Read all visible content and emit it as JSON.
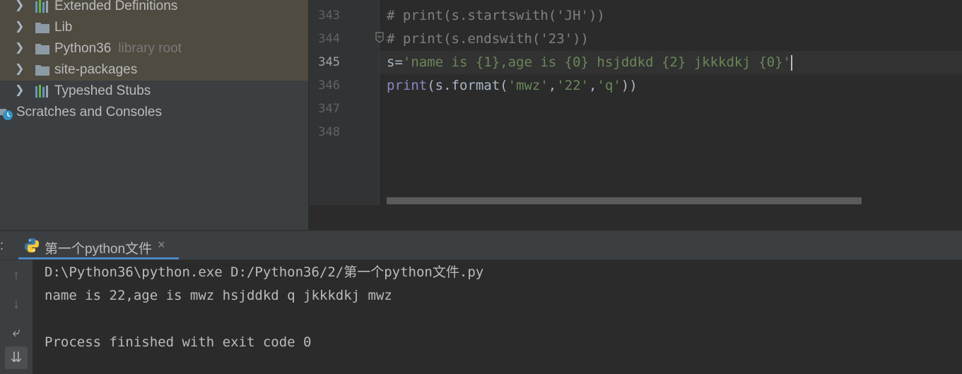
{
  "project_tree": {
    "items": [
      {
        "label": "Extended Definitions",
        "icon": "library-icon"
      },
      {
        "label": "Lib",
        "icon": "folder-icon"
      },
      {
        "label": "Python36",
        "sublabel": "library root",
        "icon": "folder-icon"
      },
      {
        "label": "site-packages",
        "icon": "folder-icon"
      },
      {
        "label": "Typeshed Stubs",
        "icon": "library-icon"
      },
      {
        "label": "Scratches and Consoles",
        "icon": "scratches-icon"
      }
    ]
  },
  "editor": {
    "line_numbers": [
      "343",
      "344",
      "345",
      "346",
      "347",
      "348"
    ],
    "current_line": "345",
    "lines": {
      "l343": "# print(s.startswith('JH'))",
      "l344": "# print(s.endswith('23'))",
      "l345_var": "s=",
      "l345_str": "'name is {1},age is {0} hsjddkd {2} jkkkdkj {0}'",
      "l346_fn": "print",
      "l346_a": "(s.format(",
      "l346_s1": "'mwz'",
      "l346_c1": ",",
      "l346_s2": "'22'",
      "l346_c2": ",",
      "l346_s3": "'q'",
      "l346_end": "))"
    }
  },
  "run_panel": {
    "prefix": ":",
    "tab_label": "第一个python文件",
    "tab_close": "×",
    "toolbar": {
      "up": "↑",
      "down": "↓",
      "wrap": "⤶",
      "scroll_end": "⇊"
    },
    "console_lines": [
      "D:\\Python36\\python.exe D:/Python36/2/第一个python文件.py",
      "name is 22,age is mwz hsjddkd q jkkkdkj mwz",
      "",
      "Process finished with exit code 0"
    ]
  },
  "colors": {
    "accent": "#4a88c7",
    "string": "#6a8759",
    "comment": "#808080",
    "builtin": "#8888c6",
    "highlight_row": "#4f4b41"
  }
}
